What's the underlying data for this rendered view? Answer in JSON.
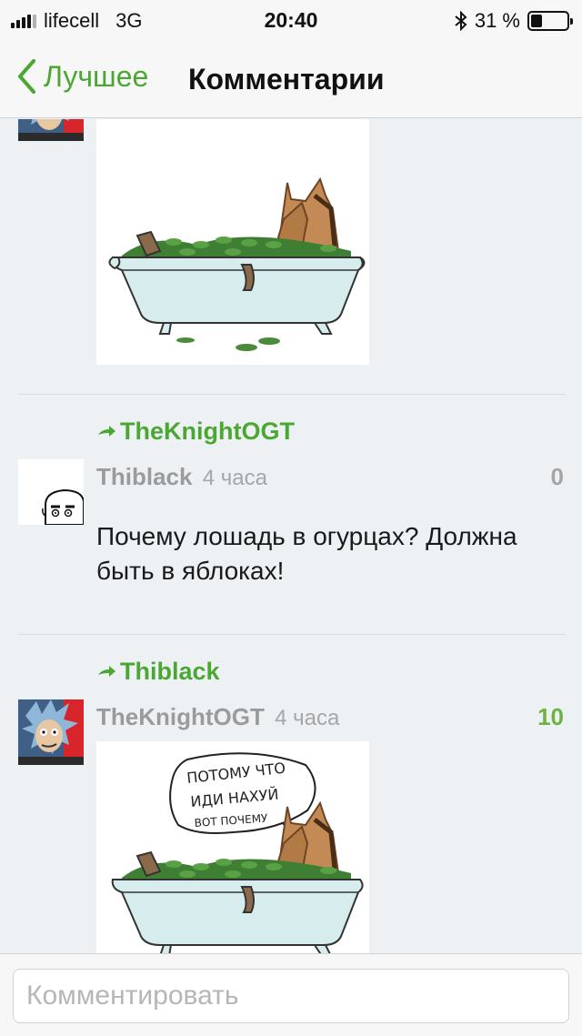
{
  "status_bar": {
    "carrier": "lifecell",
    "network": "3G",
    "time": "20:40",
    "battery_percent": "31 %",
    "battery_level": 0.31
  },
  "nav": {
    "back_label": "Лучшее",
    "title": "Комментарии"
  },
  "comments": [
    {
      "reply_to": "TheKnightOGT",
      "user": "Thiblack",
      "time": "4 часа",
      "score": "0",
      "score_color": "#a6a6a6",
      "text": "Почему лошадь в огурцах? Должна быть в яблоках!"
    },
    {
      "reply_to": "Thiblack",
      "user": "TheKnightOGT",
      "time": "4 часа",
      "score": "10",
      "score_color": "#6cb33f",
      "image_caption_lines": [
        "ПОТОМУ ЧТО",
        "ИДИ НАХУЙ",
        "ВОТ ПОЧЕМУ"
      ]
    }
  ],
  "composer": {
    "placeholder": "Комментировать"
  },
  "colors": {
    "accent": "#4aa832",
    "background": "#edf1f4",
    "bar": "#f7f7f7"
  }
}
